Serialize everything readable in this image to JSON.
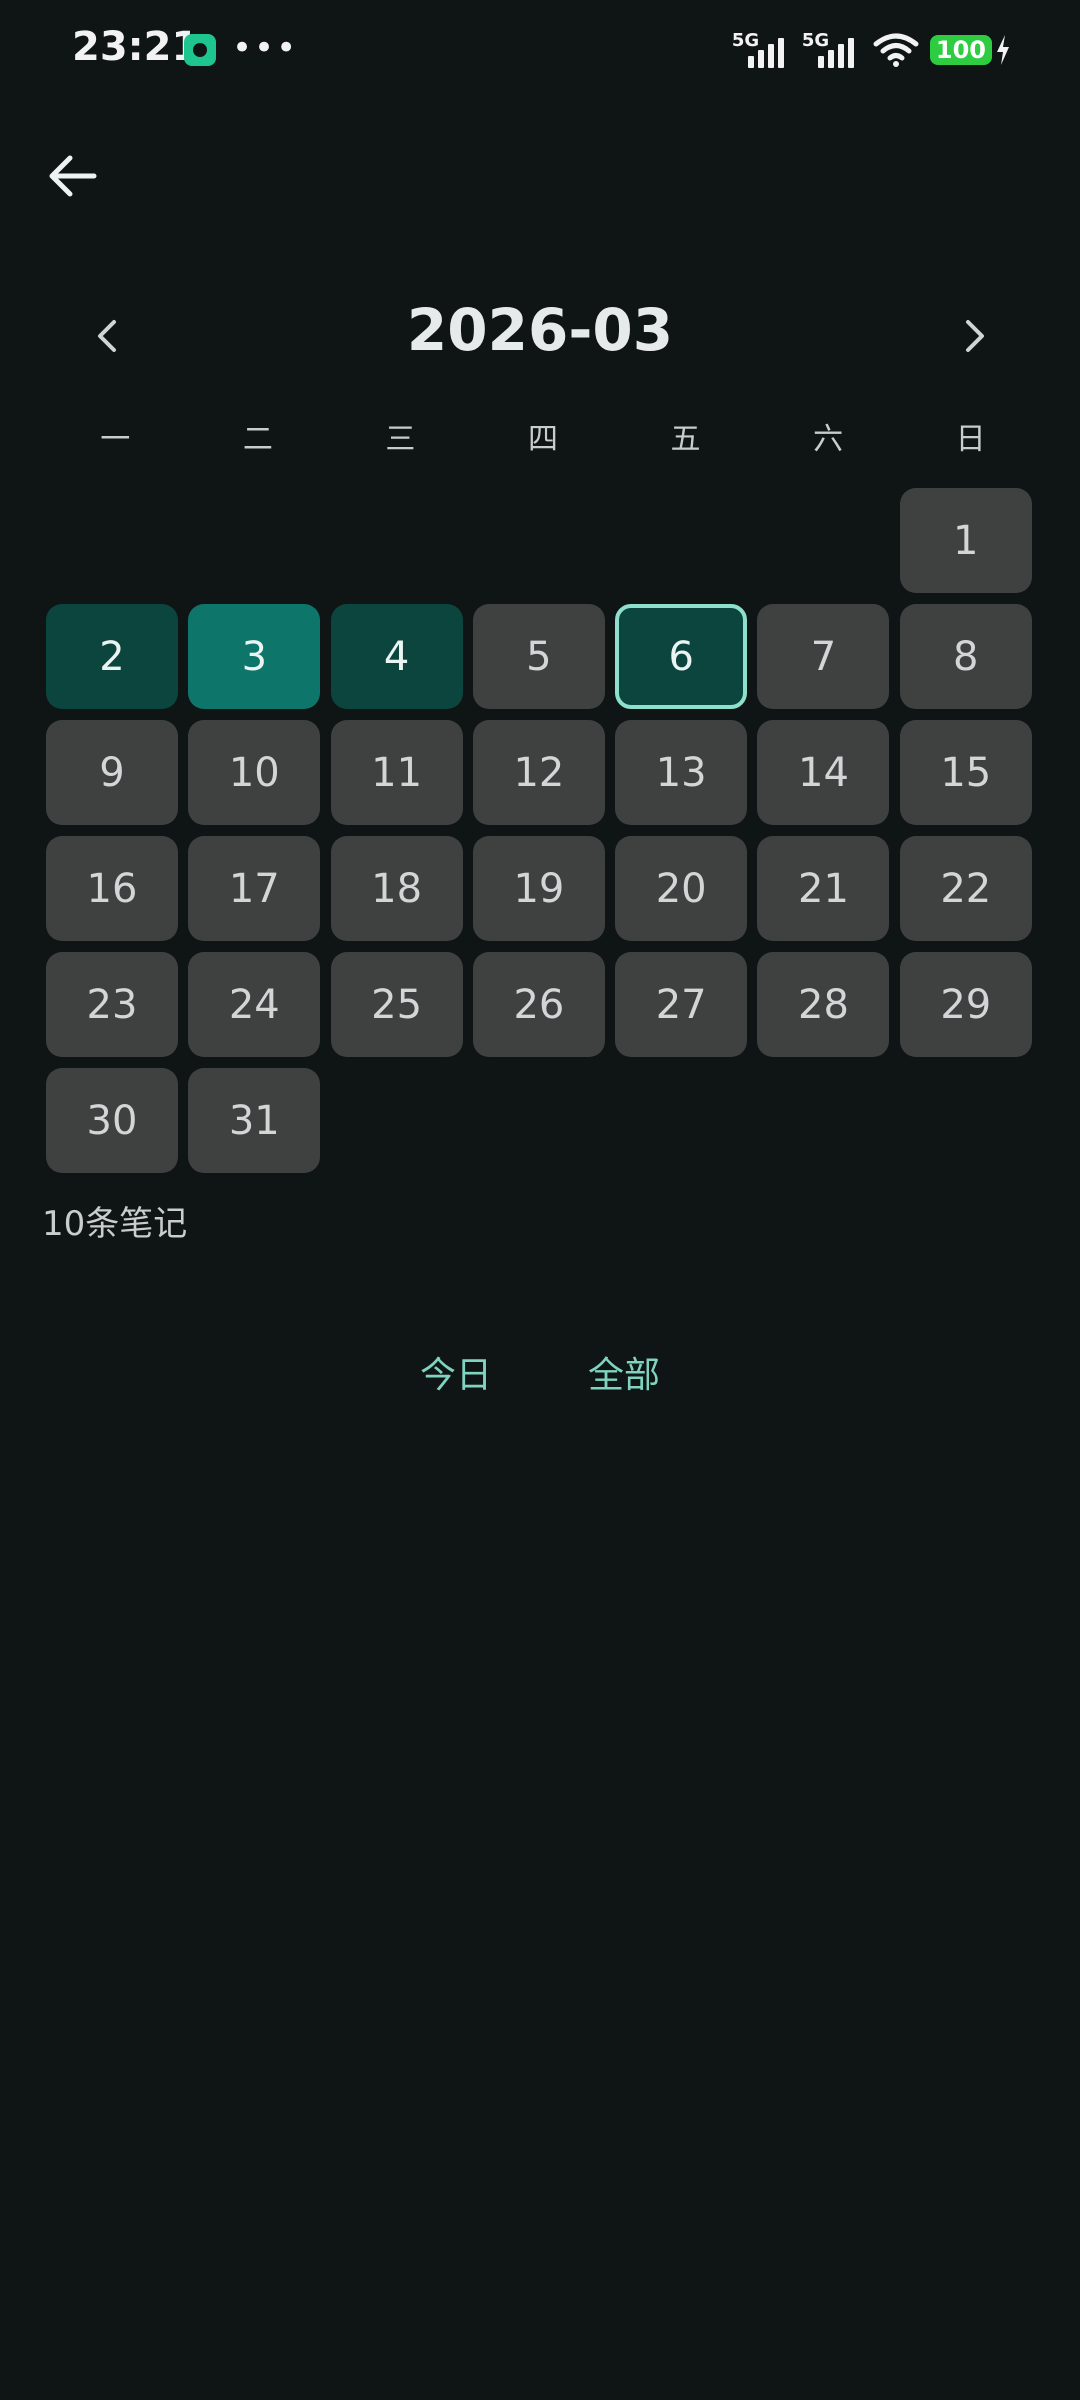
{
  "status_bar": {
    "time": "23:21",
    "network_1": "5G",
    "network_2": "5G",
    "battery": "100",
    "icons": [
      "app-notification-icon",
      "more-dots-icon",
      "signal-icon",
      "signal-icon",
      "wifi-icon",
      "battery-icon",
      "charging-icon"
    ],
    "more": "•••"
  },
  "header": {
    "back_icon": "arrow-left-icon"
  },
  "calendar": {
    "month_label": "2026-03",
    "prev_icon": "chevron-left-icon",
    "next_icon": "chevron-right-icon",
    "weekdays": [
      "一",
      "二",
      "三",
      "四",
      "五",
      "六",
      "日"
    ],
    "days": [
      {
        "label": ""
      },
      {
        "label": ""
      },
      {
        "label": ""
      },
      {
        "label": ""
      },
      {
        "label": ""
      },
      {
        "label": ""
      },
      {
        "label": "1"
      },
      {
        "label": "2",
        "state": "level-dark"
      },
      {
        "label": "3",
        "state": "level-mid"
      },
      {
        "label": "4",
        "state": "level-dark"
      },
      {
        "label": "5"
      },
      {
        "label": "6",
        "state": "today"
      },
      {
        "label": "7"
      },
      {
        "label": "8"
      },
      {
        "label": "9"
      },
      {
        "label": "10"
      },
      {
        "label": "11"
      },
      {
        "label": "12"
      },
      {
        "label": "13"
      },
      {
        "label": "14"
      },
      {
        "label": "15"
      },
      {
        "label": "16"
      },
      {
        "label": "17"
      },
      {
        "label": "18"
      },
      {
        "label": "19"
      },
      {
        "label": "20"
      },
      {
        "label": "21"
      },
      {
        "label": "22"
      },
      {
        "label": "23"
      },
      {
        "label": "24"
      },
      {
        "label": "25"
      },
      {
        "label": "26"
      },
      {
        "label": "27"
      },
      {
        "label": "28"
      },
      {
        "label": "29"
      },
      {
        "label": "30"
      },
      {
        "label": "31"
      }
    ],
    "colors": {
      "cell_default": "#3f4141",
      "level_dark": "#0b453e",
      "level_mid": "#0e756a",
      "today_border": "#8ee0cc"
    }
  },
  "notes": {
    "count_label": "10条笔记"
  },
  "actions": {
    "today_label": "今日",
    "all_label": "全部",
    "accent": "#7fd3c0"
  }
}
